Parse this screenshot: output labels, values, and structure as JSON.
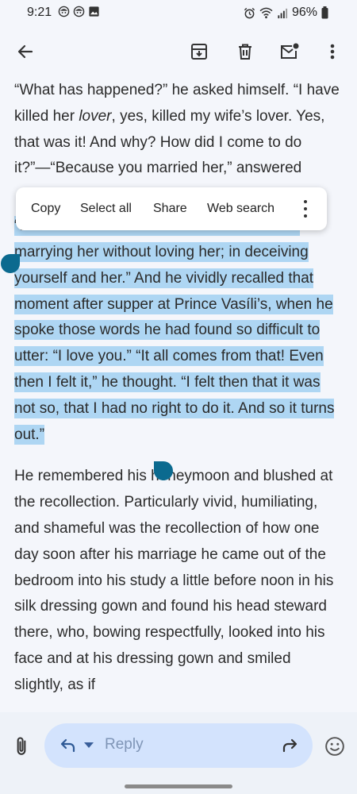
{
  "status_bar": {
    "time": "9:21",
    "battery": "96%",
    "icons": [
      "notification-face-icon",
      "notification-face-icon",
      "image-icon",
      "alarm-icon",
      "wifi-icon",
      "signal-icon",
      "battery-icon"
    ]
  },
  "app_bar": {
    "icons": [
      "back-arrow-icon",
      "archive-icon",
      "delete-icon",
      "mark-unread-icon",
      "more-vert-icon"
    ]
  },
  "email_body": {
    "para1": {
      "before": "“What has happened?” he asked himself. “I have killed her ",
      "emphasis": "lover",
      "after": ", yes, killed my wife’s lover. Yes, that was it! And why? How did I come to do it?”—“Because you married her,” answered"
    },
    "selected_text": "“But in what was I to blame?” he asked. “In marrying her without loving her; in deceiving yourself and her.” And he vividly recalled that moment after supper at Prince Vasíli’s, when he spoke those words he had found so difficult to utter: “I love you.” “It all comes from that! Even then I felt it,” he thought. “I felt then that it was not so, that I had no right to do it. And so it turns out.”",
    "para3": "He remembered his honeymoon and blushed at the recollection. Particularly vivid, humiliating, and shameful was the recollection of how one day soon after his marriage he came out of the bedroom into his study a little before noon in his silk dressing gown and found his head steward there, who, bowing respectfully, looked into his face and at his dressing gown and smiled slightly, as if"
  },
  "context_menu": {
    "copy": "Copy",
    "select_all": "Select all",
    "share": "Share",
    "web_search": "Web search"
  },
  "reply_bar": {
    "placeholder": "Reply"
  },
  "colors": {
    "selection": "#aed6f3",
    "handle": "#0b6a8f",
    "reply_pill": "#d3e3fd",
    "background": "#f4f6fb"
  }
}
